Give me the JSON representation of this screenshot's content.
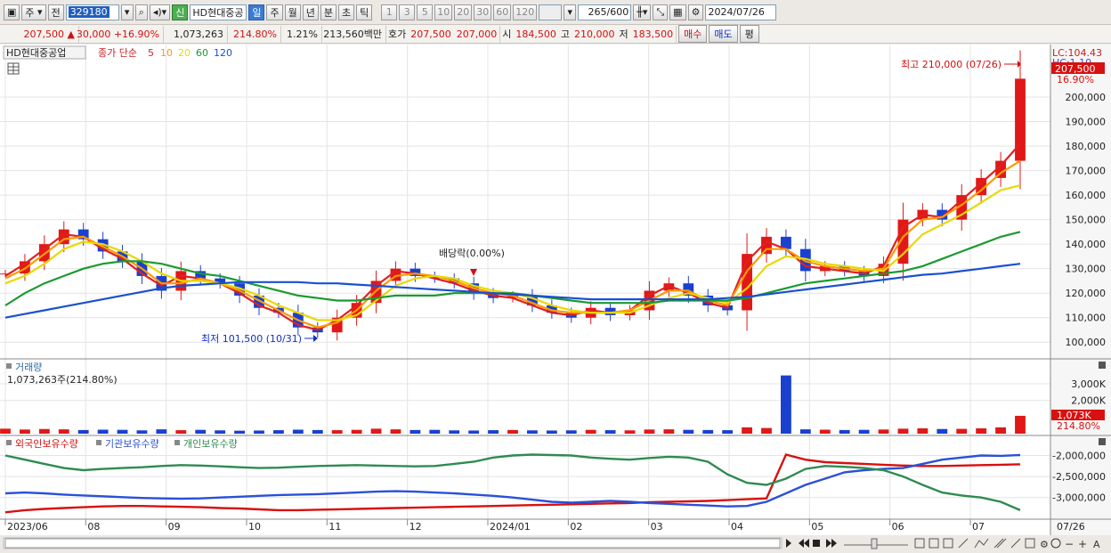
{
  "toolbar": {
    "period_type": "주",
    "compare_label": "전",
    "stock_code": "329180",
    "new_label": "신",
    "stock_name": "HD현대중공",
    "period_buttons": [
      "일",
      "주",
      "월",
      "년",
      "분",
      "초",
      "틱"
    ],
    "interval_buttons": [
      "1",
      "3",
      "5",
      "10",
      "20",
      "30",
      "60",
      "120"
    ],
    "count_value": "265",
    "count_max": "/600",
    "date": "2024/07/26"
  },
  "quote": {
    "price": "207,500",
    "change": "30,000",
    "change_pct": "+16.90%",
    "volume": "1,073,263",
    "volume_ratio": "214.80%",
    "turnover_rate": "1.21%",
    "amount": "213,560백만",
    "bid_ask_label": "호가",
    "ask": "207,500",
    "bid": "207,000",
    "open_label": "시",
    "open": "184,500",
    "high_label": "고",
    "high": "210,000",
    "low_label": "저",
    "low": "183,500",
    "buy_label": "매수",
    "sell_label": "매도",
    "avg_label": "평"
  },
  "price_panel": {
    "stock_tag": "HD현대중공업",
    "ma_label": "종가 단순",
    "ma_periods": [
      "5",
      "10",
      "20",
      "60",
      "120"
    ],
    "ma_colors": [
      "#e02020",
      "#ff9900",
      "#e8d800",
      "#1a9a30",
      "#1a50d0"
    ],
    "lc_label": "LC:104.43",
    "hc_label": "HC:1.10",
    "current_price_tag": "207,500",
    "current_pct_tag": "16.90%",
    "high_annotation": "최고 210,000 (07/26)",
    "low_annotation": "최저 101,500 (10/31)",
    "event_annotation": "배당락(0.00%)"
  },
  "volume_panel": {
    "title": "거래량",
    "value_text": "1,073,263주(214.80%)",
    "current_tag": "1,073K",
    "current_pct_tag": "214.80%"
  },
  "holdings_panel": {
    "legend": [
      "외국인보유수량",
      "기관보유수량",
      "개인보유수량"
    ],
    "colors": [
      "#d81010",
      "#2a50d8",
      "#2e8b50"
    ]
  },
  "x_axis": {
    "labels": [
      "2023/06",
      "08",
      "09",
      "10",
      "11",
      "12",
      "2024/01",
      "02",
      "03",
      "04",
      "05",
      "06",
      "07"
    ],
    "last_date": "07/26"
  },
  "chart_data": [
    {
      "type": "line",
      "title": "",
      "y_ticks": [
        100000,
        110000,
        120000,
        130000,
        140000,
        150000,
        160000,
        170000,
        180000,
        190000,
        200000
      ],
      "y_tick_labels": [
        "100,000",
        "110,000",
        "120,000",
        "130,000",
        "140,000",
        "150,000",
        "160,000",
        "170,000",
        "180,000",
        "190,000",
        "200,000"
      ],
      "ylim": [
        95000,
        212000
      ],
      "x_range": [
        "2023/06",
        "2024/07/26"
      ],
      "grid": true,
      "series": [
        {
          "name": "종가",
          "values": [
            128000,
            133000,
            140000,
            146000,
            142000,
            137000,
            133000,
            127000,
            121000,
            129000,
            126000,
            124000,
            119000,
            114000,
            112000,
            106000,
            104000,
            110000,
            116000,
            125000,
            130000,
            127000,
            126000,
            124000,
            120000,
            118000,
            119000,
            115000,
            112000,
            110000,
            114000,
            111000,
            113000,
            121000,
            124000,
            119000,
            115000,
            113000,
            136000,
            143000,
            138000,
            129000,
            131000,
            129000,
            127000,
            132000,
            150000,
            154000,
            150000,
            160000,
            167000,
            174000,
            207500
          ]
        },
        {
          "name": "5",
          "values": [
            127000,
            132000,
            138000,
            144000,
            143000,
            138000,
            134000,
            128000,
            123000,
            127000,
            126000,
            124000,
            120000,
            115000,
            112000,
            107000,
            105000,
            109000,
            115000,
            123000,
            129000,
            128000,
            126000,
            124000,
            121000,
            119000,
            118000,
            115000,
            112000,
            111000,
            113000,
            112000,
            113000,
            119000,
            123000,
            120000,
            116000,
            114000,
            133000,
            141000,
            138000,
            131000,
            130000,
            129000,
            128000,
            131000,
            147000,
            152000,
            151000,
            158000,
            165000,
            172000,
            181000
          ]
        },
        {
          "name": "10",
          "values": [
            126000,
            130000,
            136000,
            142000,
            143000,
            139000,
            135000,
            130000,
            124000,
            124000,
            126000,
            124000,
            121000,
            117000,
            113000,
            109000,
            106000,
            108000,
            113000,
            121000,
            127000,
            128000,
            127000,
            125000,
            122000,
            120000,
            119000,
            116000,
            113000,
            112000,
            112000,
            112000,
            113000,
            117000,
            121000,
            121000,
            117000,
            115000,
            129000,
            138000,
            138000,
            133000,
            131000,
            130000,
            129000,
            130000,
            143000,
            150000,
            151000,
            156000,
            162000,
            169000,
            174000
          ]
        },
        {
          "name": "20",
          "values": [
            124000,
            127000,
            132000,
            138000,
            141000,
            140000,
            137000,
            133000,
            128000,
            125000,
            125000,
            124000,
            122000,
            119000,
            115000,
            112000,
            109000,
            109000,
            111000,
            117000,
            123000,
            126000,
            127000,
            126000,
            123000,
            121000,
            120000,
            118000,
            115000,
            113000,
            112000,
            112000,
            112000,
            115000,
            118000,
            120000,
            118000,
            116000,
            122000,
            131000,
            135000,
            134000,
            132000,
            131000,
            130000,
            129000,
            136000,
            144000,
            148000,
            152000,
            157000,
            162000,
            164000
          ]
        },
        {
          "name": "60",
          "values": [
            115000,
            120000,
            124000,
            127000,
            130000,
            132000,
            133000,
            133000,
            132000,
            130000,
            128000,
            127000,
            125000,
            123000,
            121000,
            119000,
            118000,
            117000,
            117000,
            118000,
            119000,
            119000,
            119000,
            120000,
            120000,
            120000,
            120000,
            119000,
            118000,
            117000,
            116000,
            116000,
            116000,
            116000,
            117000,
            117000,
            117000,
            117000,
            118000,
            120000,
            122000,
            124000,
            125000,
            126000,
            127000,
            128000,
            129000,
            131000,
            134000,
            137000,
            140000,
            143000,
            145000
          ]
        },
        {
          "name": "120",
          "values": [
            110000,
            111500,
            113000,
            114500,
            116000,
            117500,
            119000,
            120500,
            122000,
            123000,
            123500,
            124000,
            124500,
            124500,
            124500,
            124500,
            124000,
            124000,
            123500,
            123000,
            122500,
            122000,
            121500,
            121000,
            120500,
            120000,
            119500,
            119000,
            118500,
            118000,
            117500,
            117500,
            117500,
            117500,
            117500,
            117500,
            117500,
            118000,
            118500,
            119500,
            120500,
            121500,
            122500,
            123500,
            124500,
            125500,
            126500,
            127500,
            128000,
            129000,
            130000,
            131000,
            132000
          ]
        }
      ]
    },
    {
      "type": "bar",
      "title": "",
      "y_ticks": [
        2000000,
        3000000
      ],
      "y_tick_labels": [
        "2,000K",
        "3,000K"
      ],
      "ylim": [
        0,
        3800000
      ],
      "series": [
        {
          "name": "",
          "values": [
            300000,
            250000,
            280000,
            260000,
            220000,
            240000,
            230000,
            200000,
            260000,
            210000,
            230000,
            200000,
            180000,
            190000,
            210000,
            240000,
            220000,
            210000,
            230000,
            300000,
            260000,
            220000,
            230000,
            200000,
            190000,
            210000,
            220000,
            200000,
            190000,
            200000,
            230000,
            210000,
            200000,
            250000,
            260000,
            230000,
            220000,
            210000,
            380000,
            340000,
            3500000,
            260000,
            240000,
            220000,
            230000,
            250000,
            300000,
            320000,
            280000,
            290000,
            320000,
            380000,
            1073263
          ]
        }
      ]
    },
    {
      "type": "line",
      "title": "",
      "y_ticks": [
        -3000000,
        -2500000,
        -2000000
      ],
      "y_tick_labels": [
        "-3,000,000",
        "-2,500,000",
        "-2,000,000"
      ],
      "ylim": [
        -3450000,
        -1800000
      ],
      "series": [
        {
          "name": "외국인보유수량",
          "values": [
            -3350000,
            -3300000,
            -3270000,
            -3250000,
            -3230000,
            -3210000,
            -3200000,
            -3200000,
            -3210000,
            -3220000,
            -3230000,
            -3250000,
            -3260000,
            -3280000,
            -3300000,
            -3300000,
            -3290000,
            -3280000,
            -3270000,
            -3260000,
            -3250000,
            -3240000,
            -3230000,
            -3220000,
            -3210000,
            -3200000,
            -3190000,
            -3180000,
            -3170000,
            -3160000,
            -3150000,
            -3140000,
            -3130000,
            -3110000,
            -3100000,
            -3090000,
            -3080000,
            -3060000,
            -3040000,
            -3020000,
            -1980000,
            -2100000,
            -2160000,
            -2180000,
            -2200000,
            -2220000,
            -2240000,
            -2250000,
            -2250000,
            -2240000,
            -2230000,
            -2220000,
            -2210000
          ]
        },
        {
          "name": "기관보유수량",
          "values": [
            -2900000,
            -2880000,
            -2900000,
            -2930000,
            -2950000,
            -2970000,
            -2990000,
            -3010000,
            -3020000,
            -3030000,
            -3020000,
            -3000000,
            -2980000,
            -2960000,
            -2940000,
            -2930000,
            -2920000,
            -2900000,
            -2880000,
            -2860000,
            -2850000,
            -2860000,
            -2880000,
            -2900000,
            -2930000,
            -2960000,
            -3000000,
            -3050000,
            -3100000,
            -3120000,
            -3100000,
            -3080000,
            -3100000,
            -3130000,
            -3150000,
            -3170000,
            -3190000,
            -3210000,
            -3200000,
            -3100000,
            -2900000,
            -2700000,
            -2550000,
            -2400000,
            -2350000,
            -2320000,
            -2300000,
            -2200000,
            -2100000,
            -2050000,
            -2000000,
            -2010000,
            -1990000
          ]
        },
        {
          "name": "개인보유수량",
          "values": [
            -2000000,
            -2100000,
            -2200000,
            -2300000,
            -2350000,
            -2320000,
            -2300000,
            -2280000,
            -2250000,
            -2230000,
            -2240000,
            -2260000,
            -2280000,
            -2300000,
            -2290000,
            -2270000,
            -2250000,
            -2240000,
            -2230000,
            -2240000,
            -2250000,
            -2260000,
            -2250000,
            -2200000,
            -2150000,
            -2050000,
            -2000000,
            -1980000,
            -1990000,
            -2000000,
            -2050000,
            -2080000,
            -2100000,
            -2060000,
            -2030000,
            -2050000,
            -2150000,
            -2450000,
            -2650000,
            -2700000,
            -2550000,
            -2320000,
            -2250000,
            -2270000,
            -2300000,
            -2350000,
            -2500000,
            -2700000,
            -2880000,
            -2950000,
            -3000000,
            -3100000,
            -3300000
          ]
        }
      ]
    }
  ]
}
